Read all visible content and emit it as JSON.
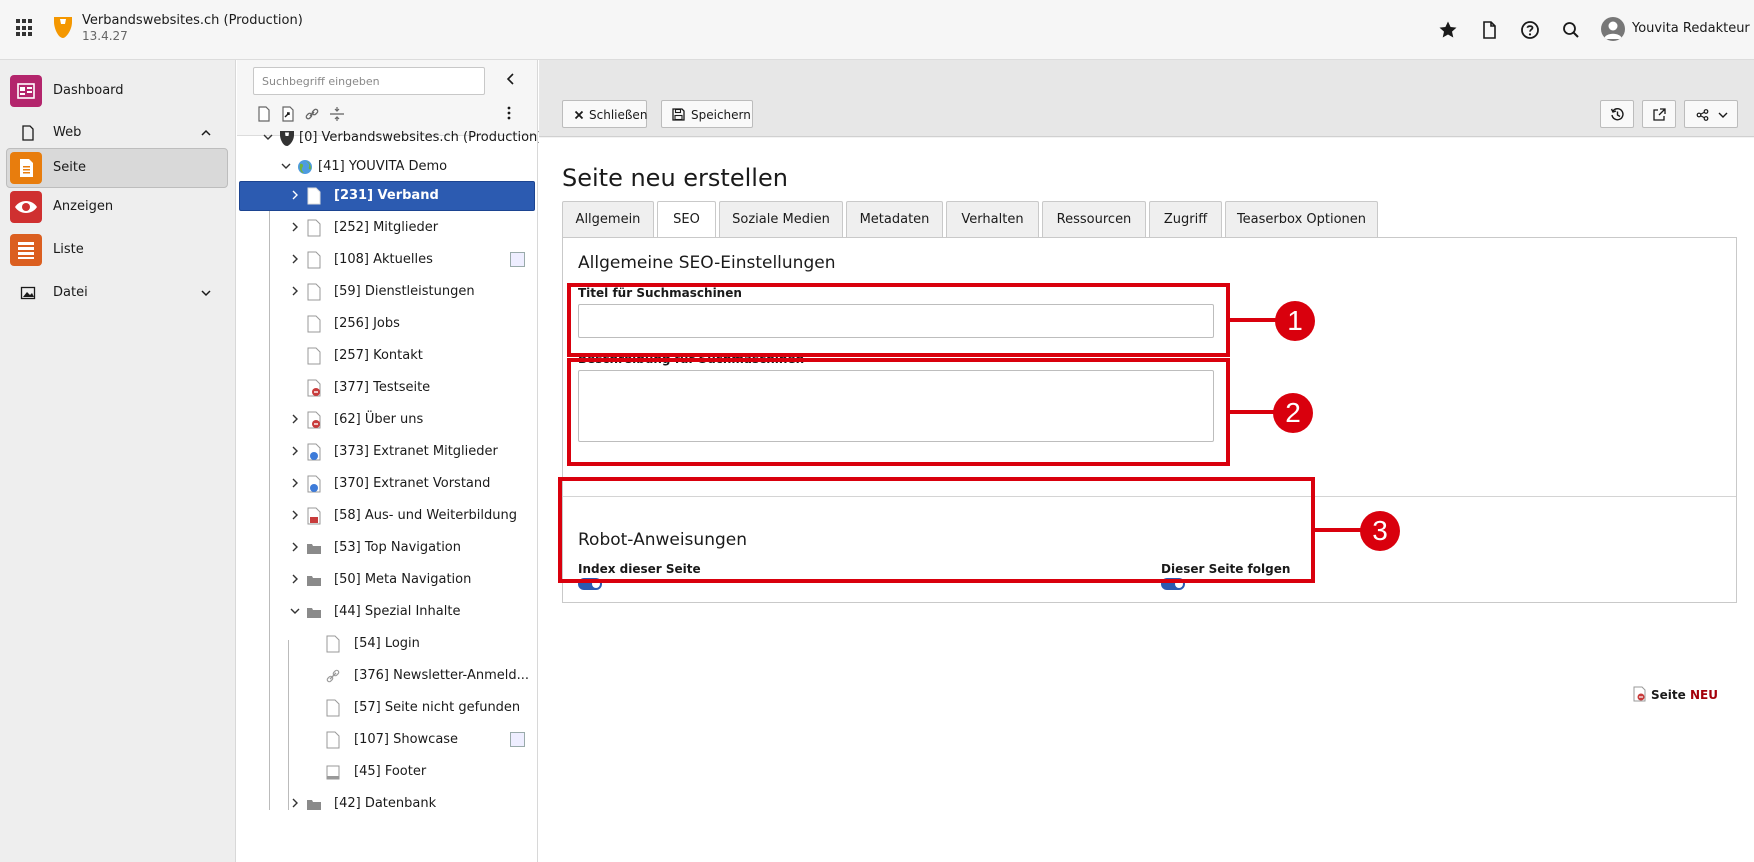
{
  "topbar": {
    "site_title": "Verbandswebsites.ch (Production)",
    "version": "13.4.27",
    "user_name": "Youvita Redakteur",
    "icons": [
      "bookmark-star-icon",
      "document-icon",
      "help-icon",
      "search-icon",
      "user-avatar-icon"
    ]
  },
  "modules": {
    "items": [
      {
        "label": "Dashboard",
        "icon": "dashboard-icon",
        "color": "#b3256c"
      },
      {
        "label": "Web",
        "icon": "page-icon",
        "group": true,
        "expanded": true
      },
      {
        "label": "Seite",
        "icon": "page-module-icon",
        "color": "#e87d0d",
        "active": true
      },
      {
        "label": "Anzeigen",
        "icon": "view-eye-icon",
        "color": "#cf3030"
      },
      {
        "label": "Liste",
        "icon": "list-icon",
        "color": "#db5f20"
      },
      {
        "label": "Datei",
        "icon": "file-image-icon",
        "group": true,
        "expanded": false
      }
    ]
  },
  "tree": {
    "search_placeholder": "Suchbegriff eingeben",
    "nodes": [
      {
        "label": "[0] Verbandswebsites.ch (Production)"
      },
      {
        "label": "[41] YOUVITA Demo"
      },
      {
        "label": "[231] Verband",
        "selected": true
      },
      {
        "label": "[252] Mitglieder"
      },
      {
        "label": "[108] Aktuelles"
      },
      {
        "label": "[59] Dienstleistungen"
      },
      {
        "label": "[256] Jobs"
      },
      {
        "label": "[257] Kontakt"
      },
      {
        "label": "[377] Testseite"
      },
      {
        "label": "[62] Über uns"
      },
      {
        "label": "[373] Extranet Mitglieder"
      },
      {
        "label": "[370] Extranet Vorstand"
      },
      {
        "label": "[58] Aus- und Weiterbildung"
      },
      {
        "label": "[53] Top Navigation"
      },
      {
        "label": "[50] Meta Navigation"
      },
      {
        "label": "[44] Spezial Inhalte"
      },
      {
        "label": "[54] Login"
      },
      {
        "label": "[376] Newsletter-Anmeld..."
      },
      {
        "label": "[57] Seite nicht gefunden"
      },
      {
        "label": "[107] Showcase"
      },
      {
        "label": "[45] Footer"
      },
      {
        "label": "[42] Datenbank"
      }
    ]
  },
  "docheader": {
    "close_label": "Schließen",
    "save_label": "Speichern"
  },
  "main": {
    "title": "Seite neu erstellen",
    "tabs": [
      "Allgemein",
      "SEO",
      "Soziale Medien",
      "Metadaten",
      "Verhalten",
      "Ressourcen",
      "Zugriff",
      "Teaserbox Optionen"
    ],
    "active_tab": "SEO",
    "seo_section_title": "Allgemeine SEO-Einstellungen",
    "seo_title_label": "Titel für Suchmaschinen",
    "seo_title_value": "",
    "description_label": "Beschreibung für Suchmaschinen",
    "description_value": "",
    "robots_title": "Robot-Anweisungen",
    "index_label": "Index dieser Seite",
    "index_on": true,
    "follow_label": "Dieser Seite folgen",
    "follow_on": true,
    "record_type": "Seite",
    "record_status": "NEU"
  },
  "callouts": [
    "1",
    "2",
    "3"
  ],
  "colors": {
    "selection": "#2c5bb1",
    "annotation_red": "#d9000d",
    "typo3_orange": "#f49700"
  }
}
